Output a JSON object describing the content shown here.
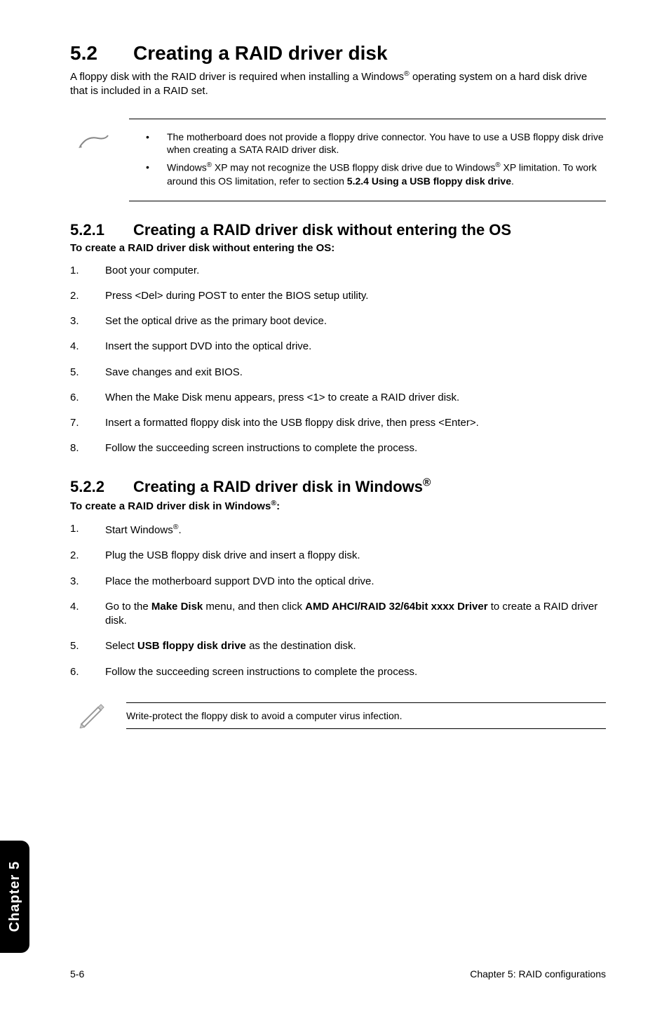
{
  "section": {
    "number": "5.2",
    "title": "Creating a RAID driver disk",
    "intro_prefix": "A floppy disk with the RAID driver is required when installing a Windows",
    "intro_suffix": " operating system on a hard disk drive that is included in a RAID set."
  },
  "note1": {
    "items": [
      {
        "prefix": "The motherboard does not provide a floppy drive connector. You have to use a USB floppy disk drive when creating a SATA RAID driver disk.",
        "reg_after_windows": false
      },
      {
        "html": "Windows<span class='sup'>®</span> XP may not recognize the USB floppy disk drive due to Windows<span class='sup'>®</span> XP limitation. To work around this OS limitation, refer to section <b>5.2.4 Using a USB floppy disk drive</b>."
      }
    ]
  },
  "sub1": {
    "number": "5.2.1",
    "title": "Creating a RAID driver disk without entering the OS",
    "lead": "To create a RAID driver disk without entering the OS:",
    "steps": [
      "Boot your computer.",
      "Press <Del> during POST to enter the BIOS setup utility.",
      "Set the optical drive as the primary boot device.",
      "Insert the support DVD into the optical drive.",
      "Save changes and exit BIOS.",
      "When the Make Disk menu appears, press <1> to create a RAID driver disk.",
      "Insert a formatted floppy disk into the USB floppy disk drive, then press <Enter>.",
      "Follow the succeeding screen instructions to complete the process."
    ]
  },
  "sub2": {
    "number": "5.2.2",
    "title_prefix": "Creating a RAID driver disk in Windows",
    "lead_prefix": "To create a RAID driver disk in Windows",
    "lead_suffix": ":",
    "steps": [
      {
        "html": "Start Windows<span class='sup'>®</span>."
      },
      {
        "html": "Plug the USB floppy disk drive and insert a floppy disk."
      },
      {
        "html": "Place the motherboard support DVD into the optical drive."
      },
      {
        "html": "Go to the <b>Make Disk</b> menu, and then click <b>AMD AHCI/RAID 32/64bit xxxx Driver</b> to create a RAID driver disk."
      },
      {
        "html": "Select <b>USB floppy disk drive</b> as the destination disk."
      },
      {
        "html": "Follow the succeeding screen instructions to complete the process."
      }
    ]
  },
  "note2": {
    "text": "Write-protect the floppy disk to avoid a computer virus infection."
  },
  "sidetab": "Chapter 5",
  "footer": {
    "left": "5-6",
    "right": "Chapter 5: RAID configurations"
  }
}
